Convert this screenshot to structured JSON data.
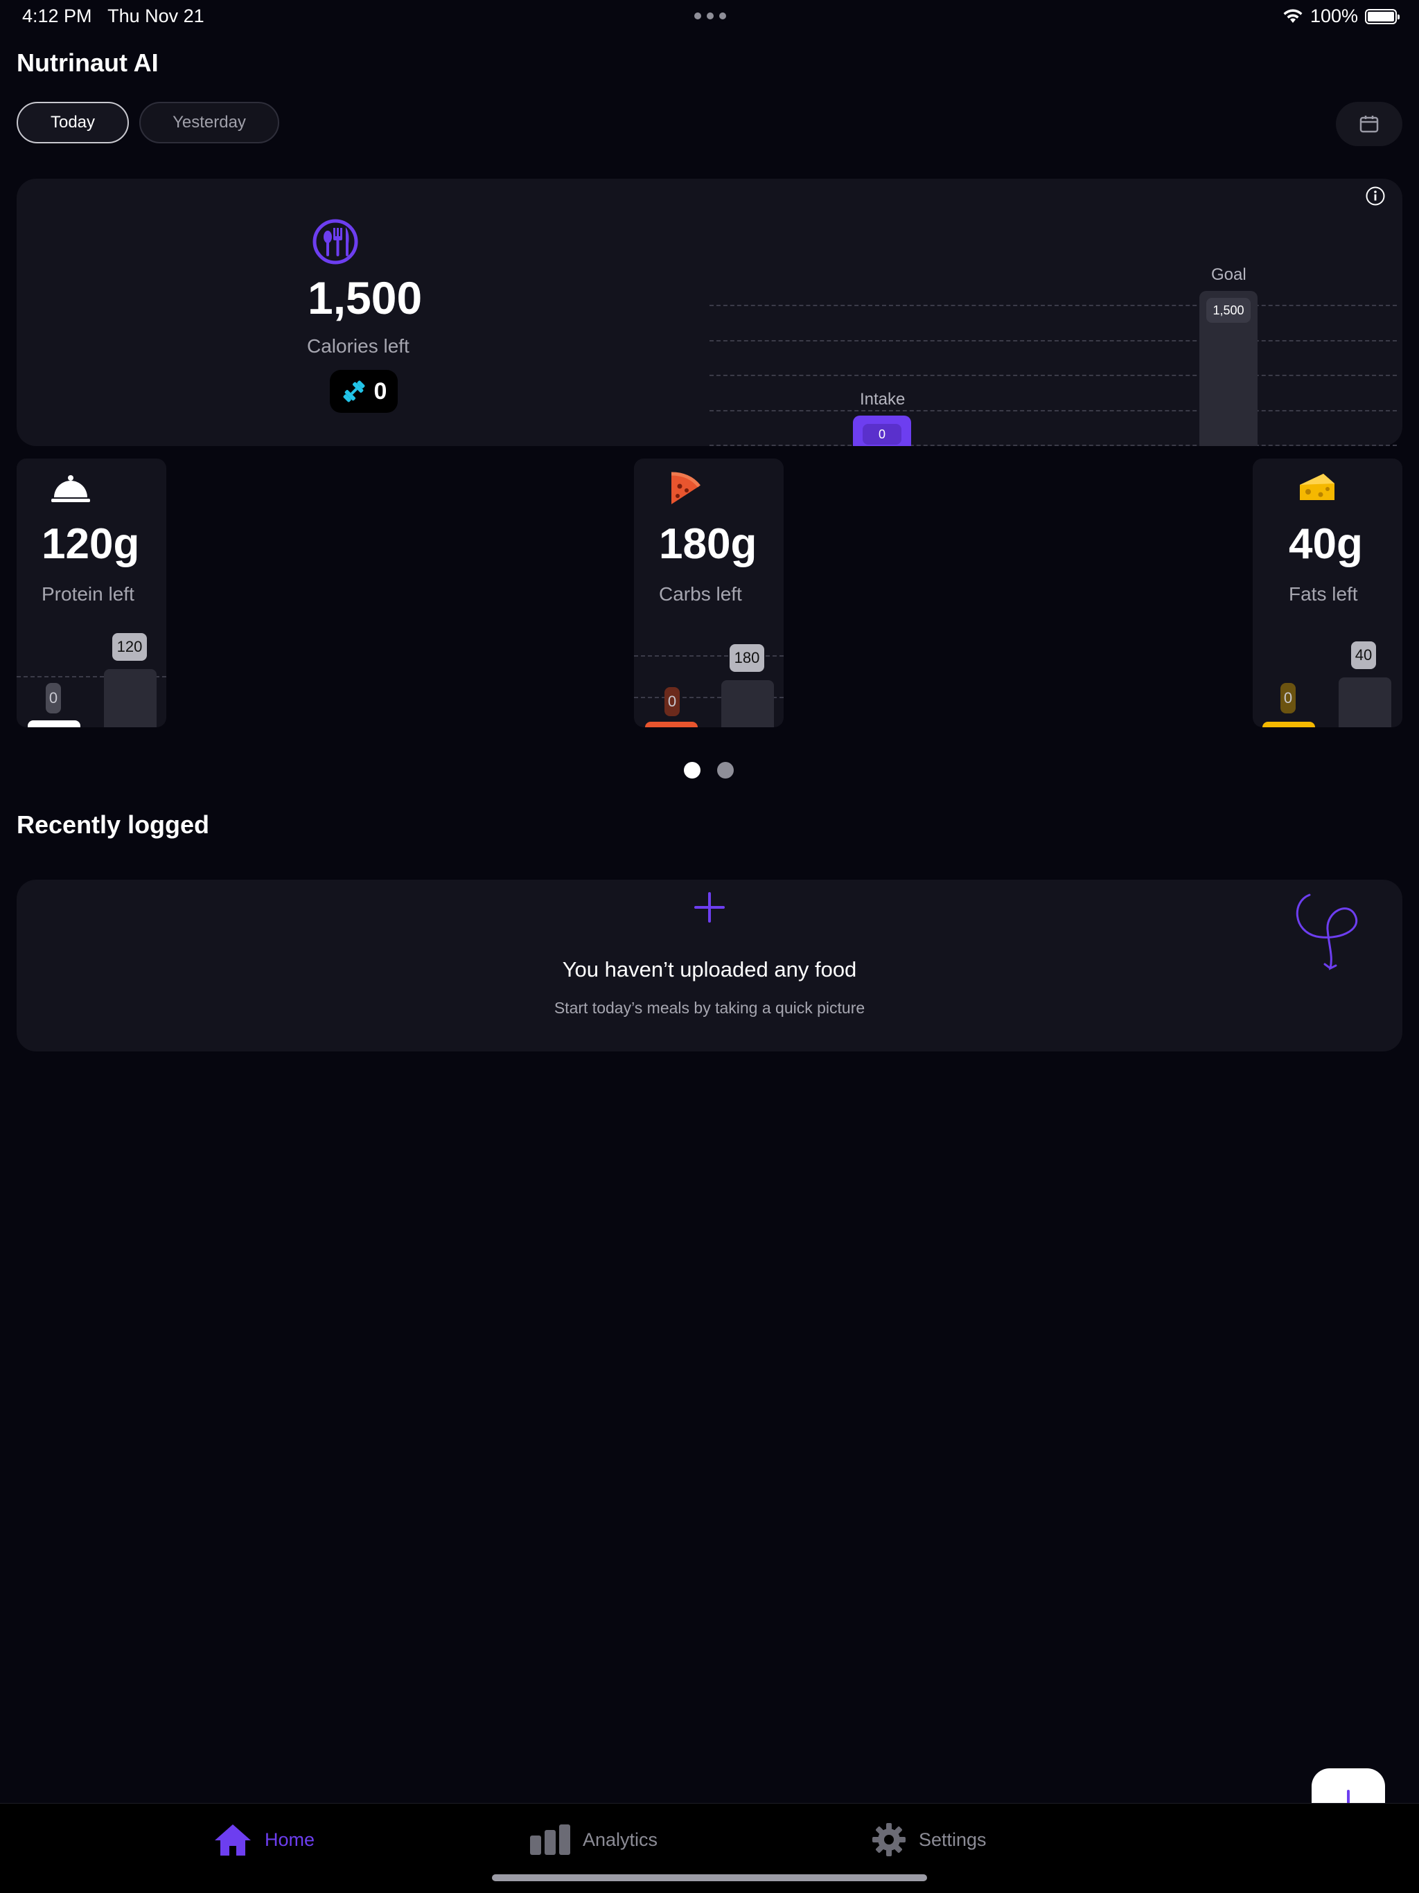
{
  "status_bar": {
    "time": "4:12 PM",
    "date": "Thu Nov 21",
    "battery": "100%",
    "icons": [
      "multitasking-dots-icon",
      "wifi-icon",
      "battery-icon"
    ]
  },
  "app": {
    "title": "Nutrinaut AI"
  },
  "day_tabs": {
    "today": "Today",
    "yesterday": "Yesterday",
    "selected": "Today",
    "calendar_icon": "calendar-icon"
  },
  "calories": {
    "value": "1,500",
    "label": "Calories left",
    "icon": "fork-knife-icon",
    "burned": "0",
    "burned_icon": "dumbbell-icon",
    "chart": {
      "goal_label": "Goal",
      "goal_value": "1,500",
      "intake_label": "Intake",
      "intake_value": "0"
    }
  },
  "macros": [
    {
      "value": "120g",
      "label": "Protein left",
      "icon": "food-cloche-icon",
      "consumed": "0",
      "goal": "120",
      "color": "#ffffff"
    },
    {
      "value": "180g",
      "label": "Carbs left",
      "icon": "pizza-icon",
      "consumed": "0",
      "goal": "180",
      "color": "#e8552e"
    },
    {
      "value": "40g",
      "label": "Fats left",
      "icon": "cheese-icon",
      "consumed": "0",
      "goal": "40",
      "color": "#f5b800"
    }
  ],
  "pager": {
    "pages": 2,
    "active": 1
  },
  "recently_logged": {
    "title": "Recently logged",
    "empty_title": "You haven’t uploaded any food",
    "empty_subtitle": "Start today’s meals by taking a quick picture"
  },
  "tabbar": {
    "items": [
      {
        "label": "Home",
        "icon": "home-icon",
        "active": true
      },
      {
        "label": "Analytics",
        "icon": "bar-chart-icon",
        "active": false
      },
      {
        "label": "Settings",
        "icon": "gear-icon",
        "active": false
      }
    ]
  },
  "colors": {
    "accent": "#6d3ef0",
    "background": "#06060f",
    "card": "#13131d"
  }
}
